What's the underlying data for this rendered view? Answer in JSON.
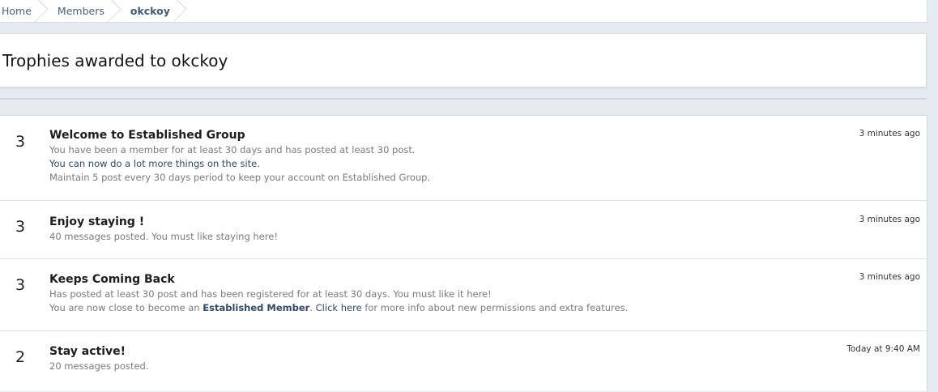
{
  "breadcrumb": {
    "items": [
      {
        "label": "Home"
      },
      {
        "label": "Members"
      },
      {
        "label": "okckoy"
      }
    ]
  },
  "page": {
    "title": "Trophies awarded to okckoy"
  },
  "trophies": [
    {
      "points": "3",
      "name": "Welcome to Established Group",
      "time": "3 minutes ago",
      "lines": [
        "You have been a member for at least 30 days and has posted at least 30 post.",
        "You can now do a lot more things on the site.",
        "Maintain 5 post every 30 days period to keep your account on Established Group."
      ]
    },
    {
      "points": "3",
      "name": "Enjoy staying !",
      "time": "3 minutes ago",
      "lines": [
        "40 messages posted. You must like staying here!"
      ]
    },
    {
      "points": "3",
      "name": "Keeps Coming Back",
      "time": "3 minutes ago",
      "lines": [
        "Has posted at least 30 post and has been registered for at least 30 days. You must like it here!"
      ],
      "line2": {
        "prefix": "You are now close to become an ",
        "link_bold": "Established Member",
        "mid": ". ",
        "link": "Click here",
        "suffix": " for more info about new permissions and extra features."
      }
    },
    {
      "points": "2",
      "name": "Stay active!",
      "time": "Today at 9:40 AM",
      "lines": [
        "20 messages posted."
      ]
    }
  ]
}
